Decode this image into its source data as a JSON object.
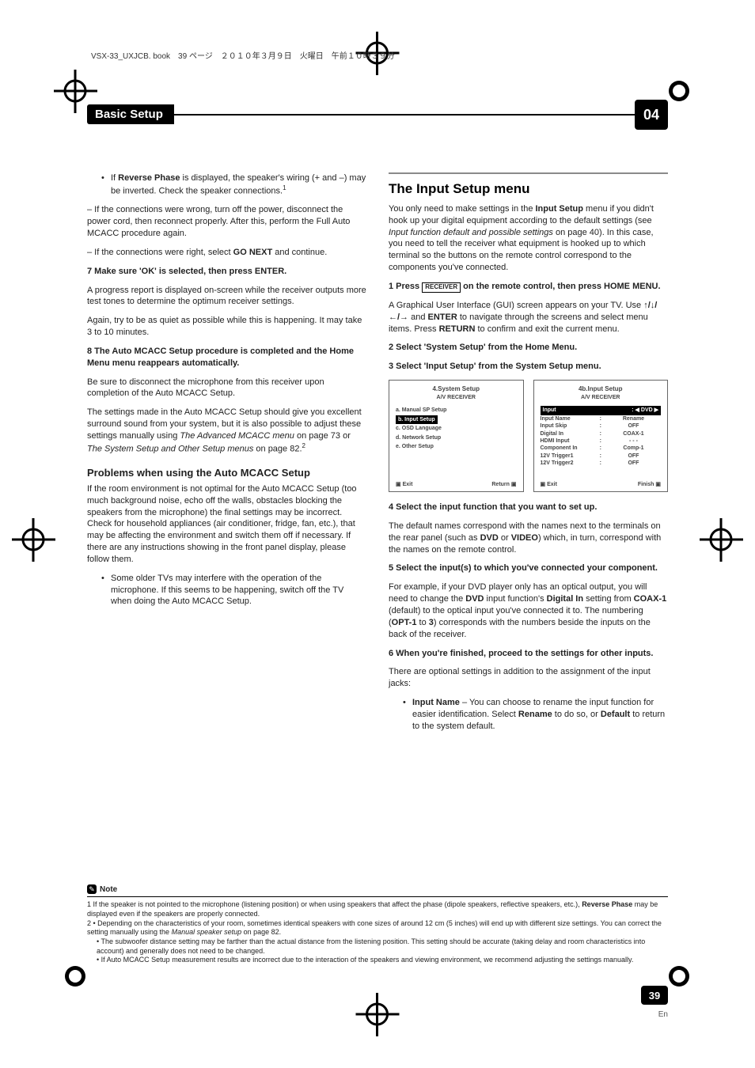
{
  "bookline": "VSX-33_UXJCB. book　39 ページ　２０１０年３月９日　火曜日　午前１０時３９分",
  "header": {
    "title": "Basic Setup",
    "chapter": "04"
  },
  "left": {
    "b1_pre": "If ",
    "b1_bold": "Reverse Phase",
    "b1_post": " is displayed, the speaker's wiring (+ and –) may be inverted. Check the speaker connections.",
    "b1_sup": "1",
    "b1_d1": "– If the connections were wrong, turn off the power, disconnect the power cord, then reconnect properly. After this, perform the Full Auto MCACC procedure again.",
    "b1_d2a": "– If the connections were right, select ",
    "b1_d2b": "GO NEXT",
    "b1_d2c": " and continue.",
    "s7": "7   Make sure 'OK' is selected, then press ENTER.",
    "s7a": "A progress report is displayed on-screen while the receiver outputs more test tones to determine the optimum receiver settings.",
    "s7b": "Again, try to be as quiet as possible while this is happening. It may take 3 to 10 minutes.",
    "s8": "8   The Auto MCACC Setup procedure is completed and the Home Menu menu reappears automatically.",
    "s8a": "Be sure to disconnect the microphone from this receiver upon completion of the Auto MCACC Setup.",
    "s8b_a": "The settings made in the Auto MCACC Setup should give you excellent surround sound from your system, but it is also possible to adjust these settings manually using ",
    "s8b_i1": "The Advanced MCACC menu",
    "s8b_b": " on page 73 or ",
    "s8b_i2": "The System Setup and Other Setup menus",
    "s8b_c": " on page 82.",
    "s8b_sup": "2",
    "sec_prob": "Problems when using the Auto MCACC Setup",
    "prob_a": "If the room environment is not optimal for the Auto MCACC Setup (too much background noise, echo off the walls, obstacles blocking the speakers from the microphone) the final settings may be incorrect. Check for household appliances (air conditioner, fridge, fan, etc.), that may be affecting the environment and switch them off if necessary. If there are any instructions showing in the front panel display, please follow them.",
    "prob_b": "Some older TVs may interfere with the operation of the microphone. If this seems to be happening, switch off the TV when doing the Auto MCACC Setup."
  },
  "right": {
    "title": "The Input Setup menu",
    "intro_a": "You only need to make settings in the ",
    "intro_b": "Input Setup",
    "intro_c": " menu if you didn't hook up your digital equipment according to the default settings (see ",
    "intro_i": "Input function default and possible settings",
    "intro_d": " on page 40). In this case, you need to tell the receiver what equipment is hooked up to which terminal so the buttons on the remote control correspond to the components you've connected.",
    "s1a": "1   Press ",
    "s1box": "RECEIVER",
    "s1b": " on the remote control, then press HOME MENU.",
    "s1p_a": "A Graphical User Interface (GUI) screen appears on your TV. Use ",
    "s1p_arrows": "↑/↓/←/→",
    "s1p_b": " and ",
    "s1p_enter": "ENTER",
    "s1p_c": " to navigate through the screens and select menu items. Press ",
    "s1p_ret": "RETURN",
    "s1p_d": " to confirm and exit the current menu.",
    "s2": "2   Select 'System Setup' from the Home Menu.",
    "s3": "3   Select 'Input Setup' from the System Setup menu.",
    "osd1": {
      "title": "4.System Setup",
      "sub": "A/V RECEIVER",
      "items": [
        "a. Manual SP Setup",
        "b. Input Setup",
        "c. OSD Language",
        "d. Network Setup",
        "e. Other Setup"
      ],
      "selected_index": 1,
      "foot_l": "Exit",
      "foot_r": "Return"
    },
    "osd2": {
      "title": "4b.Input Setup",
      "sub": "A/V RECEIVER",
      "rows": [
        {
          "k": "Input",
          "v": "DVD",
          "sel": true
        },
        {
          "k": "Input Name",
          "v": "Rename"
        },
        {
          "k": "Input Skip",
          "v": "OFF"
        },
        {
          "k": "Digital In",
          "v": "COAX-1"
        },
        {
          "k": "HDMI Input",
          "v": "- - -"
        },
        {
          "k": "Component In",
          "v": "Comp-1"
        },
        {
          "k": "12V Trigger1",
          "v": "OFF"
        },
        {
          "k": "12V Trigger2",
          "v": "OFF"
        }
      ],
      "foot_l": "Exit",
      "foot_r": "Finish"
    },
    "s4": "4   Select the input function that you want to set up.",
    "s4p_a": "The default names correspond with the names next to the terminals on the rear panel (such as ",
    "s4p_b": "DVD",
    "s4p_c": " or ",
    "s4p_d": "VIDEO",
    "s4p_e": ") which, in turn, correspond with the names on the remote control.",
    "s5": "5   Select the input(s) to which you've connected your component.",
    "s5p_a": "For example, if your DVD player only has an optical output, you will need to change the ",
    "s5p_b": "DVD",
    "s5p_c": " input function's ",
    "s5p_d": "Digital In",
    "s5p_e": " setting from ",
    "s5p_f": "COAX-1",
    "s5p_g": " (default) to the optical input you've connected it to. The numbering (",
    "s5p_h": "OPT-1",
    "s5p_i": " to ",
    "s5p_j": "3",
    "s5p_k": ") corresponds with the numbers beside the inputs on the back of the receiver.",
    "s6": "6   When you're finished, proceed to the settings for other inputs.",
    "s6p": "There are optional settings in addition to the assignment of the input jacks:",
    "s6b_a": "Input Name",
    "s6b_b": " – You can choose to rename the input function for easier identification. Select ",
    "s6b_c": "Rename",
    "s6b_d": " to do so, or ",
    "s6b_e": "Default",
    "s6b_f": " to return to the system default."
  },
  "footnote": {
    "label": "Note",
    "n1_a": "1 If the speaker is not pointed to the microphone (listening position) or when using speakers that affect the phase (dipole speakers, reflective speakers, etc.), ",
    "n1_b": "Reverse Phase",
    "n1_c": " may be displayed even if the speakers are properly connected.",
    "n2a": "2 • Depending on the characteristics of your room, sometimes identical speakers with cone sizes of around 12 cm (5 inches) will end up with different size settings. You can correct the setting manually using the ",
    "n2a_i": "Manual speaker setup",
    "n2a_b": " on page 82.",
    "n2b": "• The subwoofer distance setting may be farther than the actual distance from the listening position. This setting should be accurate (taking delay and room characteristics into account) and generally does not need to be changed.",
    "n2c": "• If Auto MCACC Setup measurement results are incorrect due to the interaction of the speakers and viewing environment, we recommend adjusting the settings manually."
  },
  "page_number": "39",
  "lang": "En"
}
